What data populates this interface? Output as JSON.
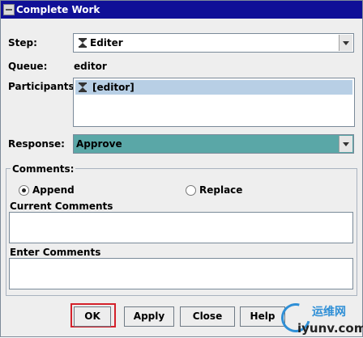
{
  "window": {
    "title": "Complete Work"
  },
  "step": {
    "label": "Step:",
    "value": "Editer"
  },
  "queue": {
    "label": "Queue:",
    "value": "editor"
  },
  "participants": {
    "label": "Participants:",
    "items": [
      "[editor]"
    ]
  },
  "response": {
    "label": "Response:",
    "value": "Approve",
    "color": "#5aa7a7"
  },
  "comments": {
    "group_label": "Comments:",
    "append_label": "Append",
    "replace_label": "Replace",
    "selected": "Append",
    "current_label": "Current Comments",
    "current_value": "",
    "enter_label": "Enter Comments",
    "enter_value": ""
  },
  "buttons": {
    "ok": "OK",
    "apply": "Apply",
    "close": "Close",
    "help": "Help"
  },
  "watermark": {
    "cn": "运维网",
    "en": "iyunv.com"
  },
  "colors": {
    "title_bar": "#101097",
    "selection": "#b8cfe5",
    "highlight_box": "#d4212b"
  }
}
